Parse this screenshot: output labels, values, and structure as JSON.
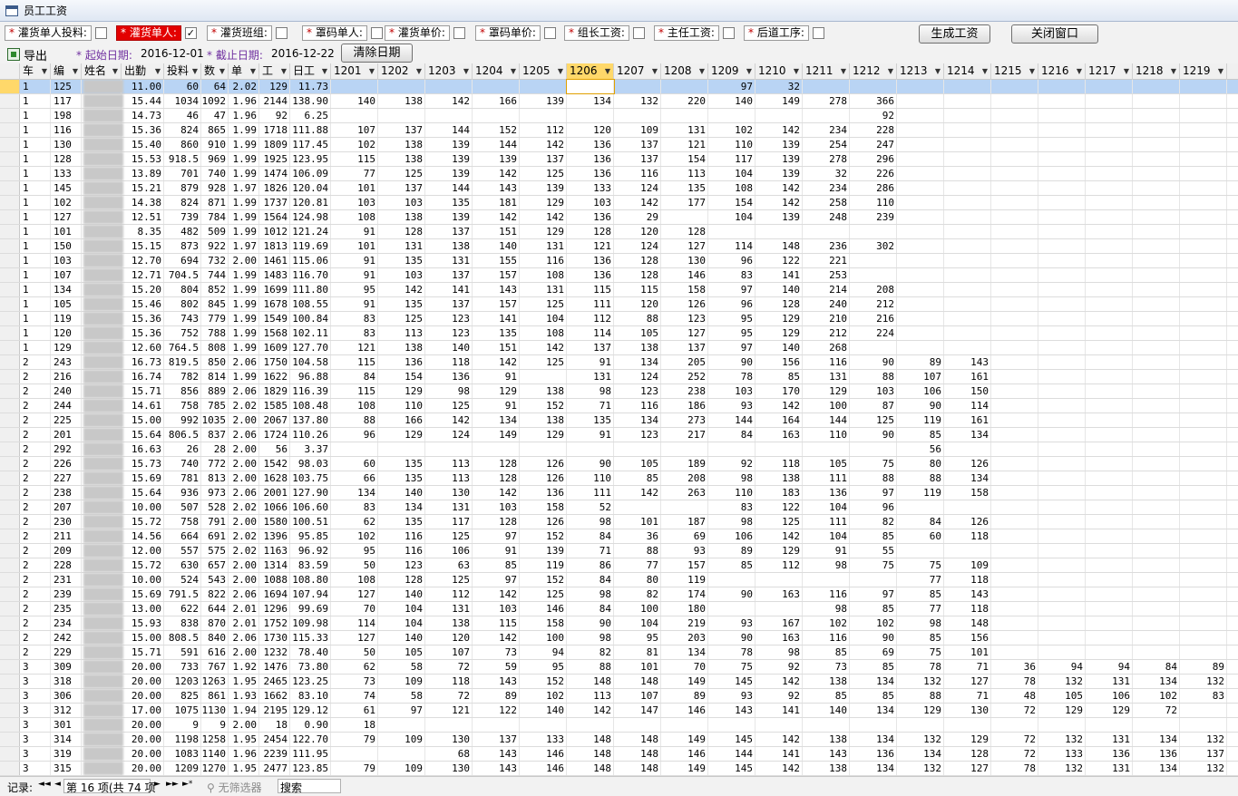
{
  "window": {
    "title": "员工工资"
  },
  "filters": [
    {
      "star": "*",
      "label": "灌货单人投料:",
      "checked": false,
      "selected": false
    },
    {
      "star": "*",
      "label": "灌货单人:",
      "checked": true,
      "selected": true
    },
    {
      "star": "*",
      "label": "灌货班组:",
      "checked": false,
      "selected": false
    },
    {
      "star": "*",
      "label": "罩码单人:",
      "checked": false,
      "selected": false
    },
    {
      "star": "*",
      "label": "灌货单价:",
      "checked": false,
      "selected": false
    },
    {
      "star": "*",
      "label": "罩码单价:",
      "checked": false,
      "selected": false
    },
    {
      "star": "*",
      "label": "组长工资:",
      "checked": false,
      "selected": false
    },
    {
      "star": "*",
      "label": "主任工资:",
      "checked": false,
      "selected": false
    },
    {
      "star": "*",
      "label": "后道工序:",
      "checked": false,
      "selected": false
    }
  ],
  "buttons": {
    "generate": "生成工资",
    "close": "关闭窗口",
    "clear_dates": "清除日期",
    "export": "导出"
  },
  "dates": {
    "start_label": "* 起始日期:",
    "start_value": "2016-12-01",
    "end_label": "* 截止日期:",
    "end_value": "2016-12-22"
  },
  "columns": [
    "车",
    "编",
    "姓名",
    "出勤",
    "投料",
    "数",
    "单",
    "工",
    "日工",
    "1201",
    "1202",
    "1203",
    "1204",
    "1205",
    "1206",
    "1207",
    "1208",
    "1209",
    "1210",
    "1211",
    "1212",
    "1213",
    "1214",
    "1215",
    "1216",
    "1217",
    "1218",
    "1219"
  ],
  "active_column": "1206",
  "rows": [
    [
      "1",
      "125",
      "",
      "11.00",
      "60",
      "64",
      "2.02",
      "129",
      "11.73",
      "",
      "",
      "",
      "",
      "",
      "",
      "",
      "",
      "97",
      "32",
      "",
      "",
      "",
      "",
      "",
      "",
      "",
      "",
      ""
    ],
    [
      "1",
      "117",
      "",
      "15.44",
      "1034",
      "1092",
      "1.96",
      "2144",
      "138.90",
      "140",
      "138",
      "142",
      "166",
      "139",
      "134",
      "132",
      "220",
      "140",
      "149",
      "278",
      "366",
      "",
      "",
      "",
      "",
      "",
      "",
      ""
    ],
    [
      "1",
      "198",
      "",
      "14.73",
      "46",
      "47",
      "1.96",
      "92",
      "6.25",
      "",
      "",
      "",
      "",
      "",
      "",
      "",
      "",
      "",
      "",
      "",
      "92",
      "",
      "",
      "",
      "",
      "",
      "",
      ""
    ],
    [
      "1",
      "116",
      "",
      "15.36",
      "824",
      "865",
      "1.99",
      "1718",
      "111.88",
      "107",
      "137",
      "144",
      "152",
      "112",
      "120",
      "109",
      "131",
      "102",
      "142",
      "234",
      "228",
      "",
      "",
      "",
      "",
      "",
      "",
      ""
    ],
    [
      "1",
      "130",
      "",
      "15.40",
      "860",
      "910",
      "1.99",
      "1809",
      "117.45",
      "102",
      "138",
      "139",
      "144",
      "142",
      "136",
      "137",
      "121",
      "110",
      "139",
      "254",
      "247",
      "",
      "",
      "",
      "",
      "",
      "",
      ""
    ],
    [
      "1",
      "128",
      "",
      "15.53",
      "918.5",
      "969",
      "1.99",
      "1925",
      "123.95",
      "115",
      "138",
      "139",
      "139",
      "137",
      "136",
      "137",
      "154",
      "117",
      "139",
      "278",
      "296",
      "",
      "",
      "",
      "",
      "",
      "",
      ""
    ],
    [
      "1",
      "133",
      "",
      "13.89",
      "701",
      "740",
      "1.99",
      "1474",
      "106.09",
      "77",
      "125",
      "139",
      "142",
      "125",
      "136",
      "116",
      "113",
      "104",
      "139",
      "32",
      "226",
      "",
      "",
      "",
      "",
      "",
      "",
      ""
    ],
    [
      "1",
      "145",
      "",
      "15.21",
      "879",
      "928",
      "1.97",
      "1826",
      "120.04",
      "101",
      "137",
      "144",
      "143",
      "139",
      "133",
      "124",
      "135",
      "108",
      "142",
      "234",
      "286",
      "",
      "",
      "",
      "",
      "",
      "",
      ""
    ],
    [
      "1",
      "102",
      "",
      "14.38",
      "824",
      "871",
      "1.99",
      "1737",
      "120.81",
      "103",
      "103",
      "135",
      "181",
      "129",
      "103",
      "142",
      "177",
      "154",
      "142",
      "258",
      "110",
      "",
      "",
      "",
      "",
      "",
      "",
      ""
    ],
    [
      "1",
      "127",
      "",
      "12.51",
      "739",
      "784",
      "1.99",
      "1564",
      "124.98",
      "108",
      "138",
      "139",
      "142",
      "142",
      "136",
      "29",
      "",
      "104",
      "139",
      "248",
      "239",
      "",
      "",
      "",
      "",
      "",
      "",
      ""
    ],
    [
      "1",
      "101",
      "",
      "8.35",
      "482",
      "509",
      "1.99",
      "1012",
      "121.24",
      "91",
      "128",
      "137",
      "151",
      "129",
      "128",
      "120",
      "128",
      "",
      "",
      "",
      "",
      "",
      "",
      "",
      "",
      "",
      "",
      ""
    ],
    [
      "1",
      "150",
      "",
      "15.15",
      "873",
      "922",
      "1.97",
      "1813",
      "119.69",
      "101",
      "131",
      "138",
      "140",
      "131",
      "121",
      "124",
      "127",
      "114",
      "148",
      "236",
      "302",
      "",
      "",
      "",
      "",
      "",
      "",
      ""
    ],
    [
      "1",
      "103",
      "",
      "12.70",
      "694",
      "732",
      "2.00",
      "1461",
      "115.06",
      "91",
      "135",
      "131",
      "155",
      "116",
      "136",
      "128",
      "130",
      "96",
      "122",
      "221",
      "",
      "",
      "",
      "",
      "",
      "",
      "",
      ""
    ],
    [
      "1",
      "107",
      "",
      "12.71",
      "704.5",
      "744",
      "1.99",
      "1483",
      "116.70",
      "91",
      "103",
      "137",
      "157",
      "108",
      "136",
      "128",
      "146",
      "83",
      "141",
      "253",
      "",
      "",
      "",
      "",
      "",
      "",
      "",
      ""
    ],
    [
      "1",
      "134",
      "",
      "15.20",
      "804",
      "852",
      "1.99",
      "1699",
      "111.80",
      "95",
      "142",
      "141",
      "143",
      "131",
      "115",
      "115",
      "158",
      "97",
      "140",
      "214",
      "208",
      "",
      "",
      "",
      "",
      "",
      "",
      ""
    ],
    [
      "1",
      "105",
      "",
      "15.46",
      "802",
      "845",
      "1.99",
      "1678",
      "108.55",
      "91",
      "135",
      "137",
      "157",
      "125",
      "111",
      "120",
      "126",
      "96",
      "128",
      "240",
      "212",
      "",
      "",
      "",
      "",
      "",
      "",
      ""
    ],
    [
      "1",
      "119",
      "",
      "15.36",
      "743",
      "779",
      "1.99",
      "1549",
      "100.84",
      "83",
      "125",
      "123",
      "141",
      "104",
      "112",
      "88",
      "123",
      "95",
      "129",
      "210",
      "216",
      "",
      "",
      "",
      "",
      "",
      "",
      ""
    ],
    [
      "1",
      "120",
      "",
      "15.36",
      "752",
      "788",
      "1.99",
      "1568",
      "102.11",
      "83",
      "113",
      "123",
      "135",
      "108",
      "114",
      "105",
      "127",
      "95",
      "129",
      "212",
      "224",
      "",
      "",
      "",
      "",
      "",
      "",
      ""
    ],
    [
      "1",
      "129",
      "",
      "12.60",
      "764.5",
      "808",
      "1.99",
      "1609",
      "127.70",
      "121",
      "138",
      "140",
      "151",
      "142",
      "137",
      "138",
      "137",
      "97",
      "140",
      "268",
      "",
      "",
      "",
      "",
      "",
      "",
      "",
      ""
    ],
    [
      "2",
      "243",
      "",
      "16.73",
      "819.5",
      "850",
      "2.06",
      "1750",
      "104.58",
      "115",
      "136",
      "118",
      "142",
      "125",
      "91",
      "134",
      "205",
      "90",
      "156",
      "116",
      "90",
      "89",
      "143",
      "",
      "",
      "",
      "",
      ""
    ],
    [
      "2",
      "216",
      "",
      "16.74",
      "782",
      "814",
      "1.99",
      "1622",
      "96.88",
      "84",
      "154",
      "136",
      "91",
      "",
      "131",
      "124",
      "252",
      "78",
      "85",
      "131",
      "88",
      "107",
      "161",
      "",
      "",
      "",
      "",
      ""
    ],
    [
      "2",
      "240",
      "",
      "15.71",
      "856",
      "889",
      "2.06",
      "1829",
      "116.39",
      "115",
      "129",
      "98",
      "129",
      "138",
      "98",
      "123",
      "238",
      "103",
      "170",
      "129",
      "103",
      "106",
      "150",
      "",
      "",
      "",
      "",
      ""
    ],
    [
      "2",
      "244",
      "",
      "14.61",
      "758",
      "785",
      "2.02",
      "1585",
      "108.48",
      "108",
      "110",
      "125",
      "91",
      "152",
      "71",
      "116",
      "186",
      "93",
      "142",
      "100",
      "87",
      "90",
      "114",
      "",
      "",
      "",
      "",
      ""
    ],
    [
      "2",
      "225",
      "",
      "15.00",
      "992",
      "1035",
      "2.00",
      "2067",
      "137.80",
      "88",
      "166",
      "142",
      "134",
      "138",
      "135",
      "134",
      "273",
      "144",
      "164",
      "144",
      "125",
      "119",
      "161",
      "",
      "",
      "",
      "",
      ""
    ],
    [
      "2",
      "201",
      "",
      "15.64",
      "806.5",
      "837",
      "2.06",
      "1724",
      "110.26",
      "96",
      "129",
      "124",
      "149",
      "129",
      "91",
      "123",
      "217",
      "84",
      "163",
      "110",
      "90",
      "85",
      "134",
      "",
      "",
      "",
      "",
      ""
    ],
    [
      "2",
      "292",
      "",
      "16.63",
      "26",
      "28",
      "2.00",
      "56",
      "3.37",
      "",
      "",
      "",
      "",
      "",
      "",
      "",
      "",
      "",
      "",
      "",
      "",
      "56",
      "",
      "",
      "",
      "",
      "",
      ""
    ],
    [
      "2",
      "226",
      "",
      "15.73",
      "740",
      "772",
      "2.00",
      "1542",
      "98.03",
      "60",
      "135",
      "113",
      "128",
      "126",
      "90",
      "105",
      "189",
      "92",
      "118",
      "105",
      "75",
      "80",
      "126",
      "",
      "",
      "",
      "",
      ""
    ],
    [
      "2",
      "227",
      "",
      "15.69",
      "781",
      "813",
      "2.00",
      "1628",
      "103.75",
      "66",
      "135",
      "113",
      "128",
      "126",
      "110",
      "85",
      "208",
      "98",
      "138",
      "111",
      "88",
      "88",
      "134",
      "",
      "",
      "",
      "",
      ""
    ],
    [
      "2",
      "238",
      "",
      "15.64",
      "936",
      "973",
      "2.06",
      "2001",
      "127.90",
      "134",
      "140",
      "130",
      "142",
      "136",
      "111",
      "142",
      "263",
      "110",
      "183",
      "136",
      "97",
      "119",
      "158",
      "",
      "",
      "",
      "",
      ""
    ],
    [
      "2",
      "207",
      "",
      "10.00",
      "507",
      "528",
      "2.02",
      "1066",
      "106.60",
      "83",
      "134",
      "131",
      "103",
      "158",
      "52",
      "",
      "",
      "83",
      "122",
      "104",
      "96",
      "",
      "",
      "",
      "",
      "",
      "",
      ""
    ],
    [
      "2",
      "230",
      "",
      "15.72",
      "758",
      "791",
      "2.00",
      "1580",
      "100.51",
      "62",
      "135",
      "117",
      "128",
      "126",
      "98",
      "101",
      "187",
      "98",
      "125",
      "111",
      "82",
      "84",
      "126",
      "",
      "",
      "",
      "",
      ""
    ],
    [
      "2",
      "211",
      "",
      "14.56",
      "664",
      "691",
      "2.02",
      "1396",
      "95.85",
      "102",
      "116",
      "125",
      "97",
      "152",
      "84",
      "36",
      "69",
      "106",
      "142",
      "104",
      "85",
      "60",
      "118",
      "",
      "",
      "",
      "",
      ""
    ],
    [
      "2",
      "209",
      "",
      "12.00",
      "557",
      "575",
      "2.02",
      "1163",
      "96.92",
      "95",
      "116",
      "106",
      "91",
      "139",
      "71",
      "88",
      "93",
      "89",
      "129",
      "91",
      "55",
      "",
      "",
      "",
      "",
      "",
      "",
      ""
    ],
    [
      "2",
      "228",
      "",
      "15.72",
      "630",
      "657",
      "2.00",
      "1314",
      "83.59",
      "50",
      "123",
      "63",
      "85",
      "119",
      "86",
      "77",
      "157",
      "85",
      "112",
      "98",
      "75",
      "75",
      "109",
      "",
      "",
      "",
      "",
      ""
    ],
    [
      "2",
      "231",
      "",
      "10.00",
      "524",
      "543",
      "2.00",
      "1088",
      "108.80",
      "108",
      "128",
      "125",
      "97",
      "152",
      "84",
      "80",
      "119",
      "",
      "",
      "",
      "",
      "77",
      "118",
      "",
      "",
      "",
      "",
      ""
    ],
    [
      "2",
      "239",
      "",
      "15.69",
      "791.5",
      "822",
      "2.06",
      "1694",
      "107.94",
      "127",
      "140",
      "112",
      "142",
      "125",
      "98",
      "82",
      "174",
      "90",
      "163",
      "116",
      "97",
      "85",
      "143",
      "",
      "",
      "",
      "",
      ""
    ],
    [
      "2",
      "235",
      "",
      "13.00",
      "622",
      "644",
      "2.01",
      "1296",
      "99.69",
      "70",
      "104",
      "131",
      "103",
      "146",
      "84",
      "100",
      "180",
      "",
      "",
      "98",
      "85",
      "77",
      "118",
      "",
      "",
      "",
      "",
      ""
    ],
    [
      "2",
      "234",
      "",
      "15.93",
      "838",
      "870",
      "2.01",
      "1752",
      "109.98",
      "114",
      "104",
      "138",
      "115",
      "158",
      "90",
      "104",
      "219",
      "93",
      "167",
      "102",
      "102",
      "98",
      "148",
      "",
      "",
      "",
      "",
      ""
    ],
    [
      "2",
      "242",
      "",
      "15.00",
      "808.5",
      "840",
      "2.06",
      "1730",
      "115.33",
      "127",
      "140",
      "120",
      "142",
      "100",
      "98",
      "95",
      "203",
      "90",
      "163",
      "116",
      "90",
      "85",
      "156",
      "",
      "",
      "",
      "",
      ""
    ],
    [
      "2",
      "229",
      "",
      "15.71",
      "591",
      "616",
      "2.00",
      "1232",
      "78.40",
      "50",
      "105",
      "107",
      "73",
      "94",
      "82",
      "81",
      "134",
      "78",
      "98",
      "85",
      "69",
      "75",
      "101",
      "",
      "",
      "",
      "",
      ""
    ],
    [
      "3",
      "309",
      "",
      "20.00",
      "733",
      "767",
      "1.92",
      "1476",
      "73.80",
      "62",
      "58",
      "72",
      "59",
      "95",
      "88",
      "101",
      "70",
      "75",
      "92",
      "73",
      "85",
      "78",
      "71",
      "36",
      "94",
      "94",
      "84",
      "89"
    ],
    [
      "3",
      "318",
      "",
      "20.00",
      "1203",
      "1263",
      "1.95",
      "2465",
      "123.25",
      "73",
      "109",
      "118",
      "143",
      "152",
      "148",
      "148",
      "149",
      "145",
      "142",
      "138",
      "134",
      "132",
      "127",
      "78",
      "132",
      "131",
      "134",
      "132"
    ],
    [
      "3",
      "306",
      "",
      "20.00",
      "825",
      "861",
      "1.93",
      "1662",
      "83.10",
      "74",
      "58",
      "72",
      "89",
      "102",
      "113",
      "107",
      "89",
      "93",
      "92",
      "85",
      "85",
      "88",
      "71",
      "48",
      "105",
      "106",
      "102",
      "83"
    ],
    [
      "3",
      "312",
      "",
      "17.00",
      "1075",
      "1130",
      "1.94",
      "2195",
      "129.12",
      "61",
      "97",
      "121",
      "122",
      "140",
      "142",
      "147",
      "146",
      "143",
      "141",
      "140",
      "134",
      "129",
      "130",
      "72",
      "129",
      "129",
      "72",
      ""
    ],
    [
      "3",
      "301",
      "",
      "20.00",
      "9",
      "9",
      "2.00",
      "18",
      "0.90",
      "18",
      "",
      "",
      "",
      "",
      "",
      "",
      "",
      "",
      "",
      "",
      "",
      "",
      "",
      "",
      "",
      "",
      "",
      ""
    ],
    [
      "3",
      "314",
      "",
      "20.00",
      "1198",
      "1258",
      "1.95",
      "2454",
      "122.70",
      "79",
      "109",
      "130",
      "137",
      "133",
      "148",
      "148",
      "149",
      "145",
      "142",
      "138",
      "134",
      "132",
      "129",
      "72",
      "132",
      "131",
      "134",
      "132"
    ],
    [
      "3",
      "319",
      "",
      "20.00",
      "1083",
      "1140",
      "1.96",
      "2239",
      "111.95",
      "",
      "",
      "68",
      "143",
      "146",
      "148",
      "148",
      "146",
      "144",
      "141",
      "143",
      "136",
      "134",
      "128",
      "72",
      "133",
      "136",
      "136",
      "137"
    ],
    [
      "3",
      "315",
      "",
      "20.00",
      "1209",
      "1270",
      "1.95",
      "2477",
      "123.85",
      "79",
      "109",
      "130",
      "143",
      "146",
      "148",
      "148",
      "149",
      "145",
      "142",
      "138",
      "134",
      "132",
      "127",
      "78",
      "132",
      "131",
      "134",
      "132"
    ]
  ],
  "navbar": {
    "label": "记录:",
    "nav_first": "◄◄",
    "nav_prev": "◄",
    "record": "第 16 项(共 74 项",
    "nav_next": "►",
    "nav_last": "►►",
    "nav_new": "►*",
    "filter": "无筛选器",
    "search": "搜索"
  }
}
